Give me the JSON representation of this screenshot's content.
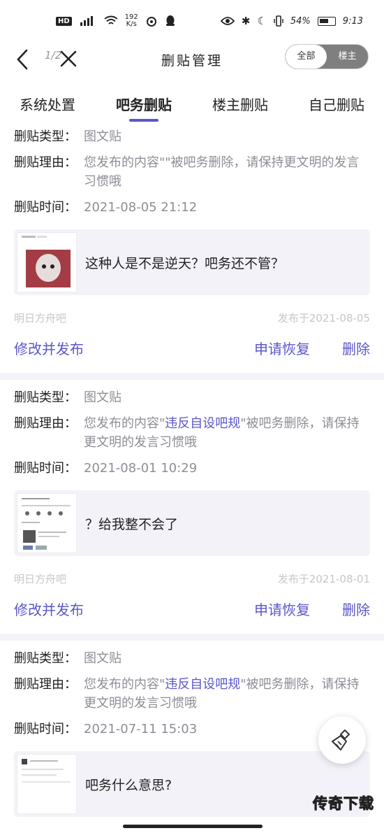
{
  "status_bar": {
    "hd": "HD",
    "net_speed_value": "192",
    "net_speed_unit": "K/s",
    "battery": "54%",
    "time": "9:13"
  },
  "nav": {
    "page_count": "1/2",
    "title": "删贴管理",
    "segment": [
      "全部",
      "楼主"
    ],
    "segment_active": "全部"
  },
  "tabs": [
    "系统处置",
    "吧务删贴",
    "楼主删贴",
    "自己删贴"
  ],
  "active_tab": "吧务删贴",
  "labels": {
    "type": "删贴类型：",
    "reason": "删贴理由：",
    "time": "删贴时间："
  },
  "records": [
    {
      "type": "图文贴",
      "reason_prefix": "您发布的内容\"\"被吧务删除，请保持更文明的发言习惯哦",
      "reason_link": "",
      "reason_suffix": "",
      "time": "2021-08-05 21:12",
      "post_text": "这种人是不是逆天？吧务还不管？",
      "forum": "明日方舟吧",
      "published": "发布于2021-08-05",
      "actions": [
        "修改并发布",
        "申请恢复",
        "删除"
      ]
    },
    {
      "type": "图文贴",
      "reason_prefix": "您发布的内容\"",
      "reason_link": "违反自设吧规",
      "reason_suffix": "\"被吧务删除，请保持更文明的发言习惯哦",
      "time": "2021-08-01 10:29",
      "post_text": "？给我整不会了",
      "forum": "明日方舟吧",
      "published": "发布于2021-08-01",
      "actions": [
        "修改并发布",
        "申请恢复",
        "删除"
      ]
    },
    {
      "type": "图文贴",
      "reason_prefix": "您发布的内容\"",
      "reason_link": "违反自设吧规",
      "reason_suffix": "\"被吧务删除，请保持更文明的发言习惯哦",
      "time": "2021-07-11 15:03",
      "post_text": "吧务什么意思?"
    }
  ],
  "watermark": "传奇下载",
  "colors": {
    "accent": "#5b56c9",
    "muted": "#8d8d96",
    "card_bg": "#f3f2f9"
  }
}
